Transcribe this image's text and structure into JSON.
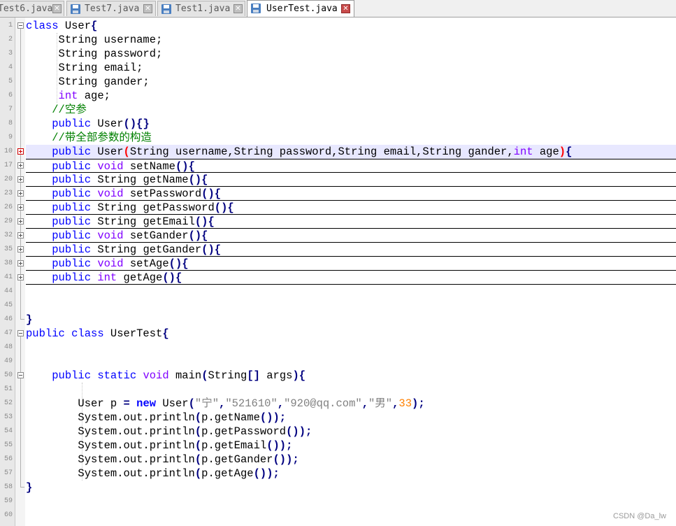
{
  "tabs": [
    {
      "label": "Test6.java"
    },
    {
      "label": "Test7.java"
    },
    {
      "label": "Test1.java"
    },
    {
      "label": "UserTest.java"
    }
  ],
  "line_numbers": [
    "1",
    "2",
    "3",
    "4",
    "5",
    "6",
    "7",
    "8",
    "9",
    "10",
    "17",
    "20",
    "23",
    "26",
    "29",
    "32",
    "35",
    "38",
    "41",
    "44",
    "45",
    "46",
    "47",
    "48",
    "49",
    "50",
    "51",
    "52",
    "53",
    "54",
    "55",
    "56",
    "57",
    "58",
    "59",
    "60"
  ],
  "code": {
    "l1": [
      "class",
      " User",
      "{"
    ],
    "l2": "String username;",
    "l3": "String password;",
    "l4": "String email;",
    "l5": "String gander;",
    "l6": [
      "int",
      " age;"
    ],
    "l7": "//空参",
    "l8": [
      "public",
      " User",
      "(){}"
    ],
    "l9": "//带全部参数的构造",
    "l10": [
      "public",
      " User",
      "(",
      "String username,String password,String email,String gander,",
      "int",
      " age",
      ")",
      "{"
    ],
    "methods": [
      [
        "public",
        " void",
        " setName",
        "(){"
      ],
      [
        "public",
        " String",
        " getName",
        "(){"
      ],
      [
        "public",
        " void",
        " setPassword",
        "(){"
      ],
      [
        "public",
        " String",
        " getPassword",
        "(){"
      ],
      [
        "public",
        " String",
        " getEmail",
        "(){"
      ],
      [
        "public",
        " void",
        " setGander",
        "(){"
      ],
      [
        "public",
        " String",
        " getGander",
        "(){"
      ],
      [
        "public",
        " void",
        " setAge",
        "(){"
      ],
      [
        "public",
        " int",
        " getAge",
        "(){"
      ]
    ],
    "close1": "}",
    "l_usertest": [
      "public",
      " class",
      " UserTest",
      "{"
    ],
    "l_main": [
      "public",
      " static",
      " void",
      " main",
      "(",
      "String",
      "[]",
      " args",
      "){"
    ],
    "l_new": [
      "User p ",
      "=",
      " ",
      "new",
      " User",
      "(",
      "\"宁\"",
      ",",
      "\"521610\"",
      ",",
      "\"920@qq.com\"",
      ",",
      "\"男\"",
      ",",
      "33",
      ");"
    ],
    "prints": [
      [
        "System.out.println",
        "(",
        "p.getName",
        "());"
      ],
      [
        "System.out.println",
        "(",
        "p.getPassword",
        "());"
      ],
      [
        "System.out.println",
        "(",
        "p.getEmail",
        "());"
      ],
      [
        "System.out.println",
        "(",
        "p.getGander",
        "());"
      ],
      [
        "System.out.println",
        "(",
        "p.getAge",
        "());"
      ]
    ],
    "close2": "}"
  },
  "watermark": "CSDN @Da_lw"
}
